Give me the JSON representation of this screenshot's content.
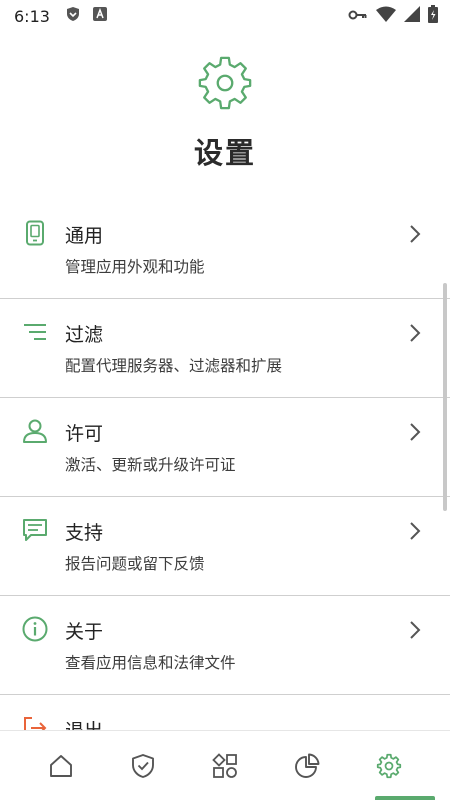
{
  "status_bar": {
    "time": "6:13",
    "icons": [
      "shield-icon",
      "a-icon",
      "key-icon",
      "wifi-icon",
      "signal-icon",
      "battery-icon"
    ]
  },
  "header": {
    "title": "设置",
    "icon": "gear-icon"
  },
  "settings": {
    "items": [
      {
        "icon": "phone-icon",
        "title": "通用",
        "subtitle": "管理应用外观和功能"
      },
      {
        "icon": "filter-icon",
        "title": "过滤",
        "subtitle": "配置代理服务器、过滤器和扩展"
      },
      {
        "icon": "user-icon",
        "title": "许可",
        "subtitle": "激活、更新或升级许可证"
      },
      {
        "icon": "chat-icon",
        "title": "支持",
        "subtitle": "报告问题或留下反馈"
      },
      {
        "icon": "info-icon",
        "title": "关于",
        "subtitle": "查看应用信息和法律文件"
      },
      {
        "icon": "logout-icon",
        "title": "退出",
        "subtitle": ""
      }
    ]
  },
  "colors": {
    "accent": "#5aaa6e",
    "logout": "#e9643a"
  },
  "bottom_nav": {
    "items": [
      {
        "icon": "home-icon"
      },
      {
        "icon": "shield-check-icon"
      },
      {
        "icon": "apps-icon"
      },
      {
        "icon": "stats-icon"
      },
      {
        "icon": "settings-gear-icon",
        "active": true
      }
    ]
  }
}
